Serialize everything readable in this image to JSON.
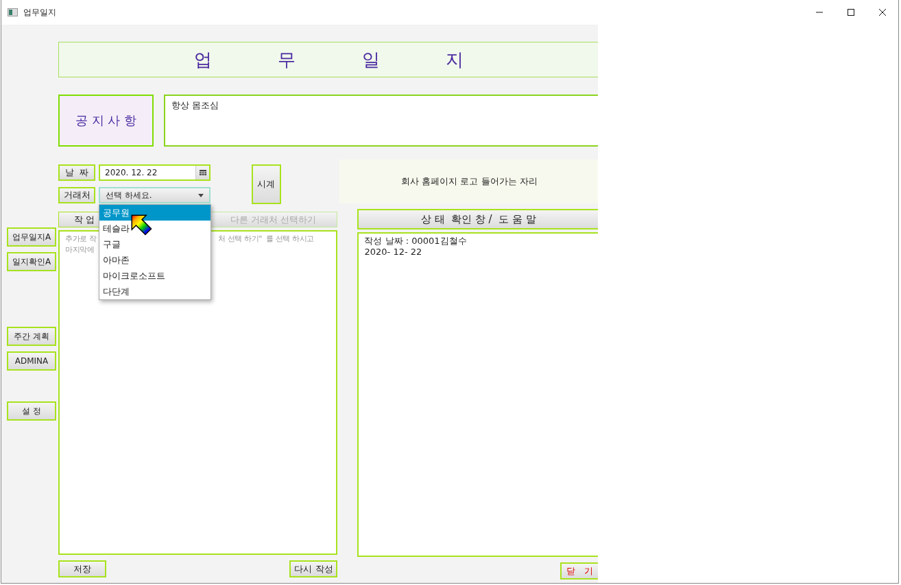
{
  "window": {
    "title": "업무일지"
  },
  "sidebar": {
    "buttons": [
      {
        "label": "업무일지A"
      },
      {
        "label": "일지확인A"
      },
      {
        "label": "주간 계획"
      },
      {
        "label": "ADMINA"
      },
      {
        "label": "설   정"
      }
    ]
  },
  "header": {
    "title": "업 무 일 지"
  },
  "notice": {
    "label": "공 지 사 항",
    "text": "항상 몸조심"
  },
  "date": {
    "label": "날  짜",
    "value": "2020. 12. 22"
  },
  "client": {
    "label": "거래처",
    "value": "선택 하세요.",
    "expanded": true,
    "options": [
      {
        "label": "공무원",
        "selected": true
      },
      {
        "label": "테슬라",
        "selected": false
      },
      {
        "label": "구글",
        "selected": false
      },
      {
        "label": "아마존",
        "selected": false
      },
      {
        "label": "마이크로소프트",
        "selected": false
      },
      {
        "label": "다단계",
        "selected": false
      }
    ]
  },
  "clock_button": "시계",
  "logo_placeholder": "회사 홈페이지 로고 들어가는 자리",
  "tabs": [
    {
      "label": "작 업",
      "disabled": false
    },
    {
      "label": "다른 거래처 선택하기",
      "disabled": true
    }
  ],
  "editor": {
    "placeholder_lines": [
      {
        "parts": [
          "추가로 작",
          "처 선택 하기\"  를 선택 하시고"
        ]
      },
      {
        "parts": [
          "마지막에"
        ]
      }
    ]
  },
  "status": {
    "title": "상 태  확인 창 /  도 움 말",
    "lines": [
      "작성 날짜 : 00001김철수",
      "2020- 12- 22"
    ]
  },
  "buttons": [
    {
      "label": "저장",
      "kind": "normal"
    },
    {
      "label": "다시 작성",
      "kind": "normal"
    },
    {
      "label": "닫   기",
      "kind": "danger"
    }
  ]
}
